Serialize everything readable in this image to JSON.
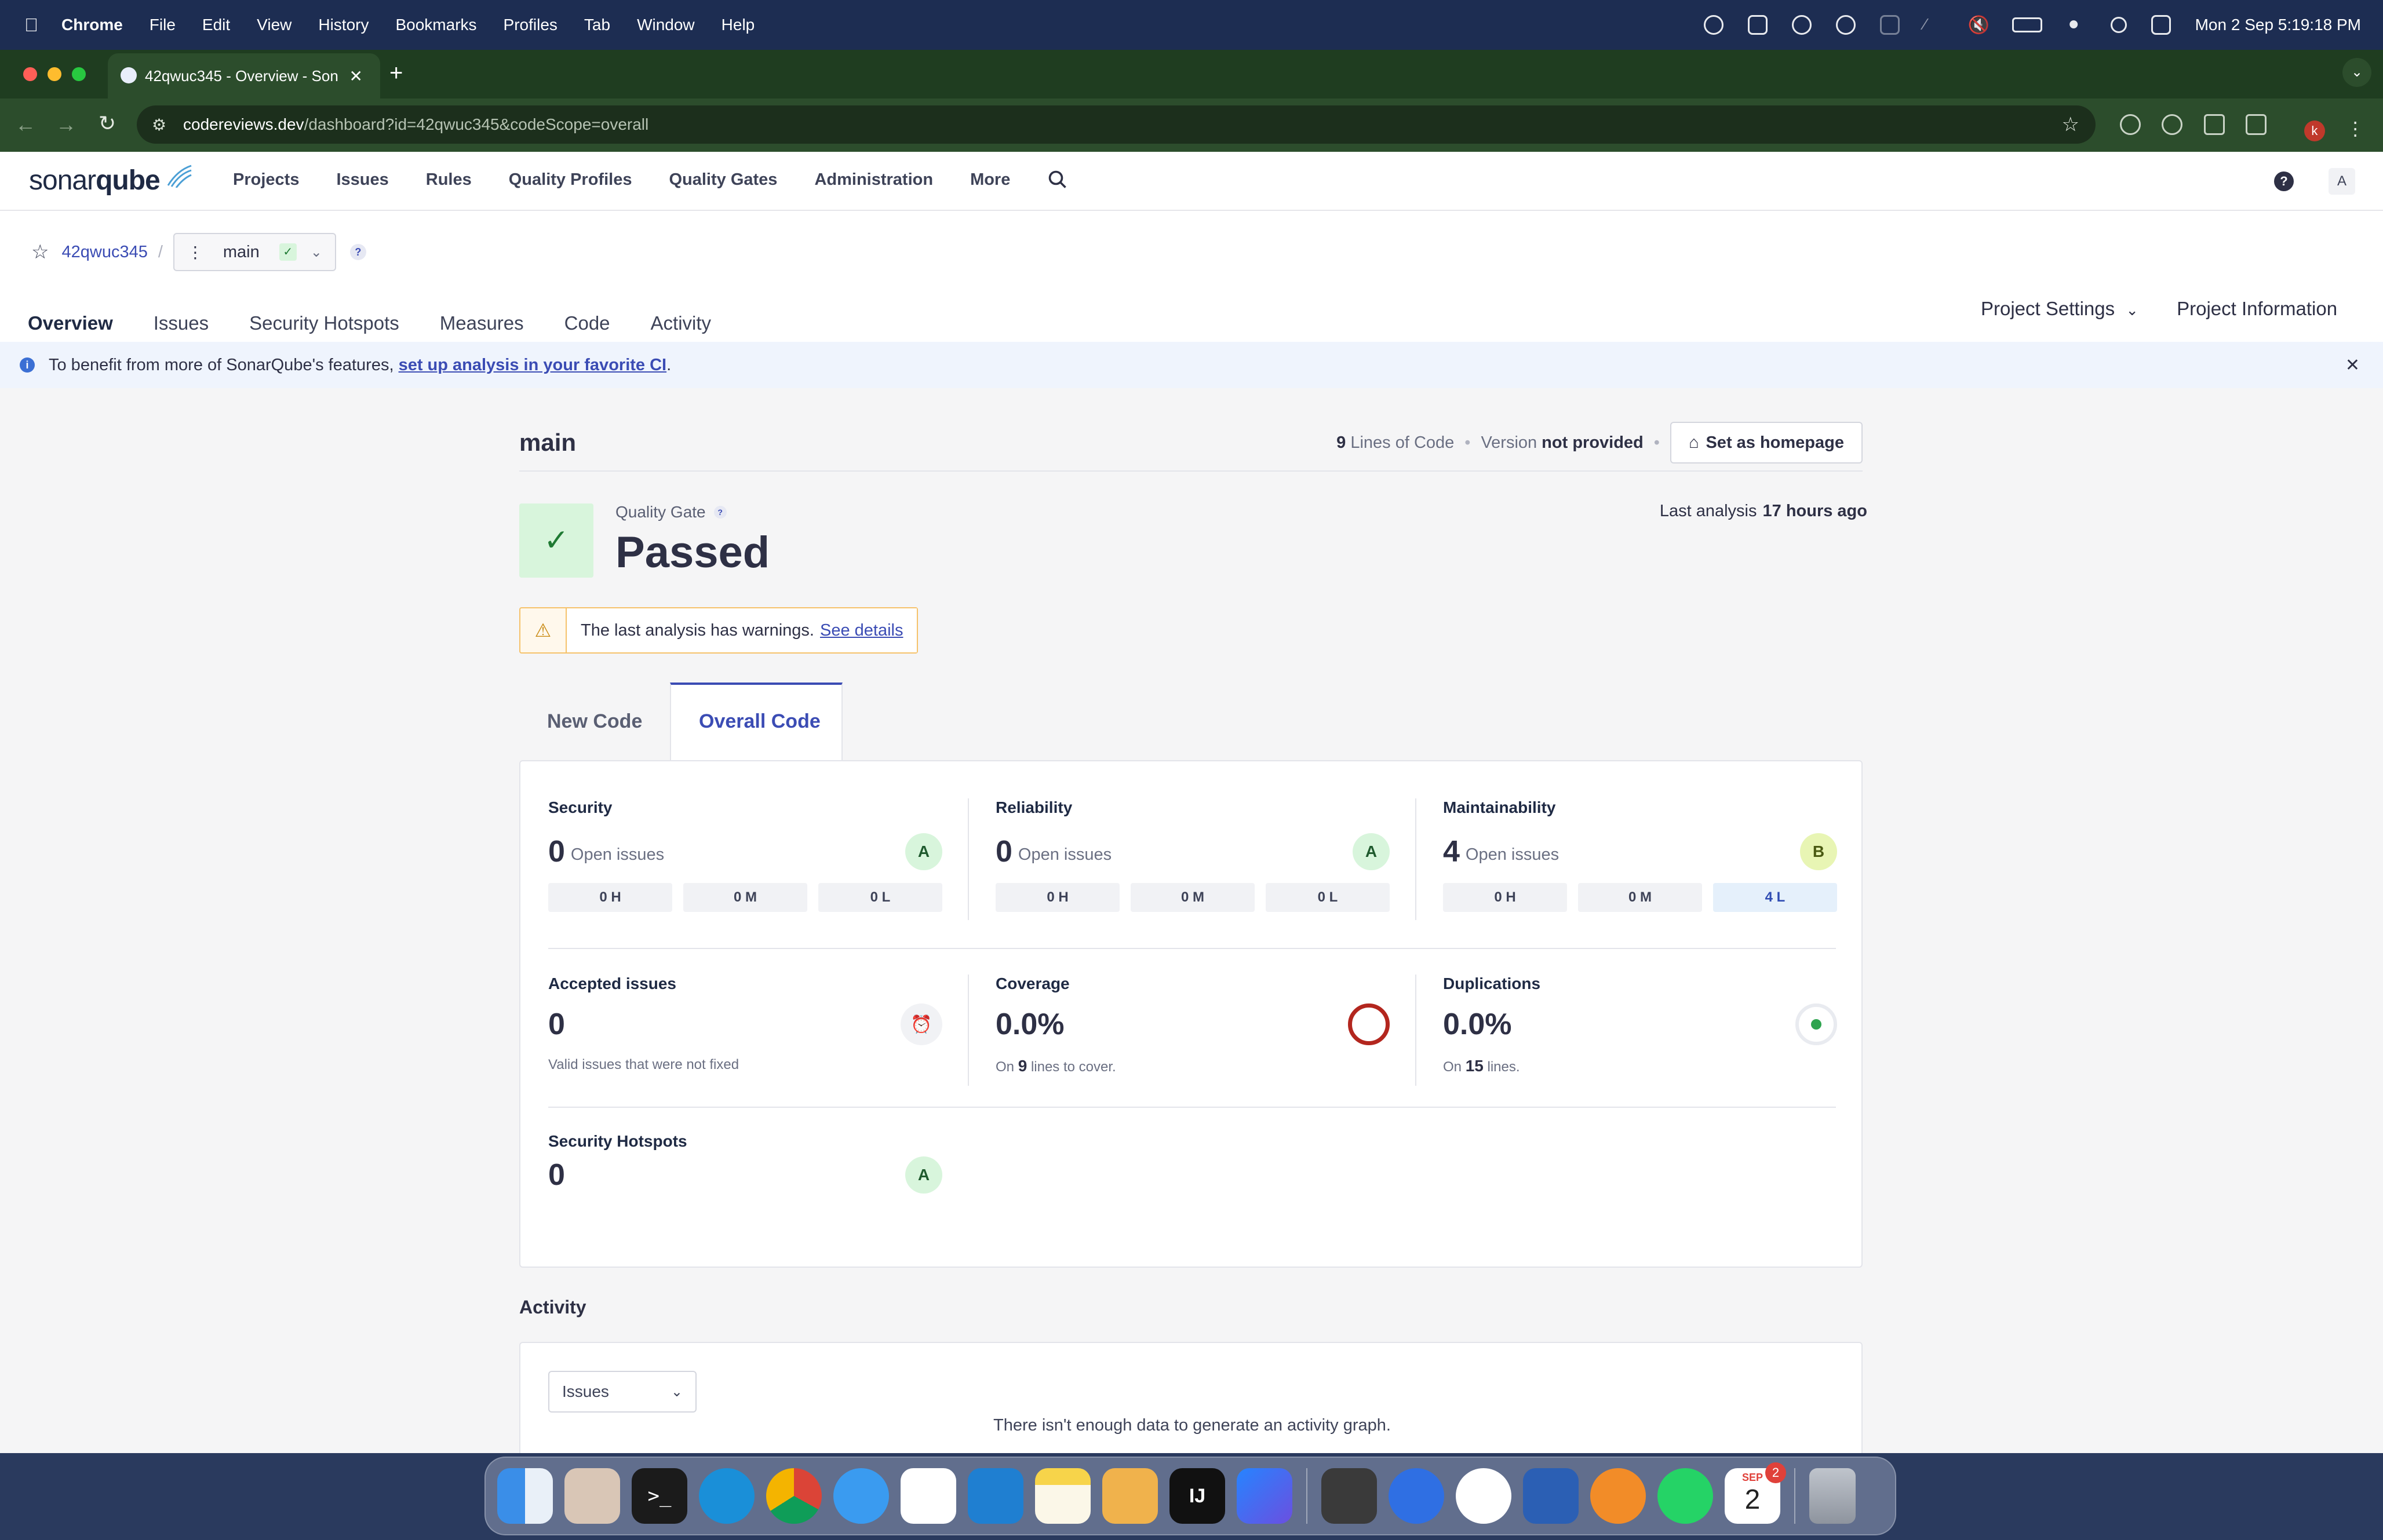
{
  "menubar": {
    "app": "Chrome",
    "items": [
      "File",
      "Edit",
      "View",
      "History",
      "Bookmarks",
      "Profiles",
      "Tab",
      "Window",
      "Help"
    ],
    "clock": "Mon 2 Sep  5:19:18 PM"
  },
  "browser": {
    "tab_title": "42qwuc345 - Overview - Son",
    "url_host": "codereviews.dev",
    "url_path": "/dashboard?id=42qwuc345&codeScope=overall",
    "profile_initial": "k"
  },
  "sq_header": {
    "logo_a": "sonar",
    "logo_b": "qube",
    "nav": [
      "Projects",
      "Issues",
      "Rules",
      "Quality Profiles",
      "Quality Gates",
      "Administration",
      "More"
    ],
    "user_initial": "A"
  },
  "project": {
    "key": "42qwuc345",
    "branch": "main",
    "tabs": [
      "Overview",
      "Issues",
      "Security Hotspots",
      "Measures",
      "Code",
      "Activity"
    ],
    "settings": "Project Settings",
    "info": "Project Information"
  },
  "infobar": {
    "text_before": "To benefit from more of SonarQube's features, ",
    "link": "set up analysis in your favorite CI",
    "text_after": "."
  },
  "dashboard": {
    "branch_title": "main",
    "loc_count": "9",
    "loc_label": "Lines of Code",
    "version_label": "Version",
    "version_value": "not provided",
    "homepage_btn": "Set as homepage",
    "qg_label": "Quality Gate",
    "qg_status": "Passed",
    "last_analysis_label": "Last analysis",
    "last_analysis_value": "17 hours ago",
    "warning_text": "The last analysis has warnings.",
    "warning_link": "See details",
    "tabs": [
      "New Code",
      "Overall Code"
    ],
    "security": {
      "title": "Security",
      "count": "0",
      "label": "Open issues",
      "rating": "A",
      "h": "0 H",
      "m": "0 M",
      "l": "0 L"
    },
    "reliability": {
      "title": "Reliability",
      "count": "0",
      "label": "Open issues",
      "rating": "A",
      "h": "0 H",
      "m": "0 M",
      "l": "0 L"
    },
    "maintainability": {
      "title": "Maintainability",
      "count": "4",
      "label": "Open issues",
      "rating": "B",
      "h": "0 H",
      "m": "0 M",
      "l": "4 L"
    },
    "accepted": {
      "title": "Accepted issues",
      "value": "0",
      "note": "Valid issues that were not fixed"
    },
    "coverage": {
      "title": "Coverage",
      "value": "0.0%",
      "note_a": "On",
      "note_num": "9",
      "note_b": "lines to cover."
    },
    "duplications": {
      "title": "Duplications",
      "value": "0.0%",
      "note_a": "On",
      "note_num": "15",
      "note_b": "lines."
    },
    "hotspots": {
      "title": "Security Hotspots",
      "value": "0",
      "rating": "A"
    },
    "activity_title": "Activity",
    "activity_select": "Issues",
    "activity_empty": "There isn't enough data to generate an activity graph."
  },
  "dock": {
    "calendar_month": "SEP",
    "calendar_day": "2",
    "calendar_badge": "2"
  },
  "colors": {
    "accent": "#3b4cb4",
    "passed_bg": "#d8f5dc",
    "passed_check": "#1f7a33",
    "rating_a_bg": "#d8f5dc",
    "rating_b_bg": "#e8f5b4",
    "coverage_ring": "#b3261e",
    "warning_border": "#f5c26b",
    "warning_bg": "#fff8ec"
  }
}
